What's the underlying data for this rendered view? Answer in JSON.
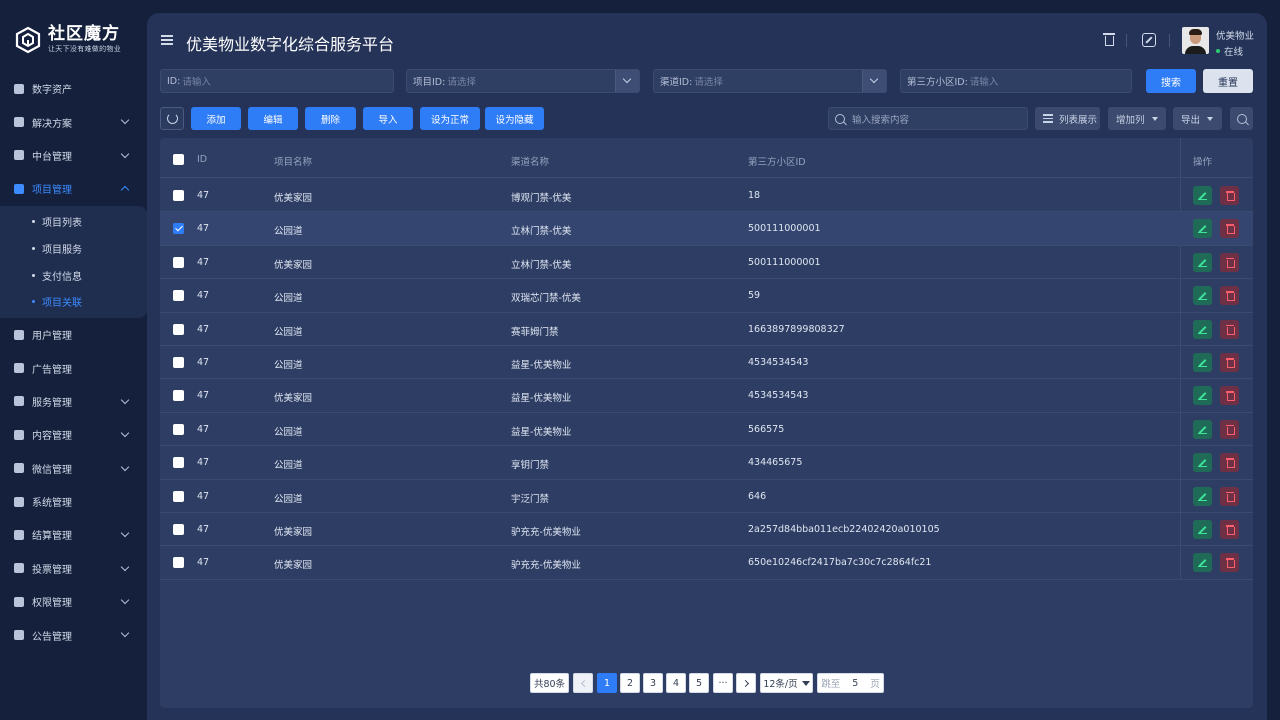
{
  "brand": {
    "title": "社区魔方",
    "subtitle": "让天下没有难做的物业"
  },
  "sidebar": {
    "items": [
      {
        "label": "数字资产",
        "icon": "digital-assets-icon",
        "chevron": false
      },
      {
        "label": "解决方案",
        "icon": "shield-icon",
        "chevron": true
      },
      {
        "label": "中台管理",
        "icon": "cube-icon",
        "chevron": true
      },
      {
        "label": "项目管理",
        "icon": "folder-icon",
        "chevron": true,
        "active": true
      },
      {
        "label": "用户管理",
        "icon": "user-icon",
        "chevron": false
      },
      {
        "label": "广告管理",
        "icon": "ad-icon",
        "chevron": false
      },
      {
        "label": "服务管理",
        "icon": "heart-icon",
        "chevron": true
      },
      {
        "label": "内容管理",
        "icon": "content-icon",
        "chevron": true
      },
      {
        "label": "微信管理",
        "icon": "wechat-icon",
        "chevron": true
      },
      {
        "label": "系统管理",
        "icon": "gear-icon",
        "chevron": false
      },
      {
        "label": "结算管理",
        "icon": "settlement-icon",
        "chevron": true
      },
      {
        "label": "投票管理",
        "icon": "vote-icon",
        "chevron": true
      },
      {
        "label": "权限管理",
        "icon": "permission-icon",
        "chevron": true
      },
      {
        "label": "公告管理",
        "icon": "megaphone-icon",
        "chevron": true
      }
    ],
    "subitems": [
      "项目列表",
      "项目服务",
      "支付信息",
      "项目关联"
    ],
    "active_sub": "项目关联"
  },
  "header": {
    "title": "优美物业数字化综合服务平台",
    "user_name": "优美物业",
    "user_status": "在线"
  },
  "filters": {
    "id_label": "ID:",
    "id_placeholder": "请输入",
    "project_label": "项目ID:",
    "project_placeholder": "请选择",
    "channel_label": "渠道ID:",
    "channel_placeholder": "请选择",
    "third_label": "第三方小区ID:",
    "third_placeholder": "请输入",
    "search": "搜索",
    "reset": "重置"
  },
  "toolbar": {
    "add": "添加",
    "edit": "编辑",
    "delete": "删除",
    "import": "导入",
    "set_normal": "设为正常",
    "set_hidden": "设为隐藏",
    "search_placeholder": "输入搜索内容",
    "list_view": "列表展示",
    "add_column": "增加列",
    "export": "导出"
  },
  "table": {
    "columns": [
      "ID",
      "项目名称",
      "渠道名称",
      "第三方小区ID",
      "操作"
    ],
    "rows": [
      {
        "id": "47",
        "project": "优美家园",
        "channel": "博观门禁-优美",
        "third": "18",
        "checked": false
      },
      {
        "id": "47",
        "project": "公园道",
        "channel": "立林门禁-优美",
        "third": "500111000001",
        "checked": true
      },
      {
        "id": "47",
        "project": "优美家园",
        "channel": "立林门禁-优美",
        "third": "500111000001",
        "checked": false
      },
      {
        "id": "47",
        "project": "公园道",
        "channel": "双瑞芯门禁-优美",
        "third": "59",
        "checked": false
      },
      {
        "id": "47",
        "project": "公园道",
        "channel": "赛菲姆门禁",
        "third": "1663897899808327",
        "checked": false
      },
      {
        "id": "47",
        "project": "公园道",
        "channel": "益星-优美物业",
        "third": "4534534543",
        "checked": false
      },
      {
        "id": "47",
        "project": "优美家园",
        "channel": "益星-优美物业",
        "third": "4534534543",
        "checked": false
      },
      {
        "id": "47",
        "project": "公园道",
        "channel": "益星-优美物业",
        "third": "566575",
        "checked": false
      },
      {
        "id": "47",
        "project": "公园道",
        "channel": "享钥门禁",
        "third": "434465675",
        "checked": false
      },
      {
        "id": "47",
        "project": "公园道",
        "channel": "宇泛门禁",
        "third": "646",
        "checked": false
      },
      {
        "id": "47",
        "project": "优美家园",
        "channel": "驴充充-优美物业",
        "third": "2a257d84bba011ecb22402420a010105",
        "checked": false
      },
      {
        "id": "47",
        "project": "优美家园",
        "channel": "驴充充-优美物业",
        "third": "650e10246cf2417ba7c30c7c2864fc21",
        "checked": false
      }
    ]
  },
  "pagination": {
    "total": "共80条",
    "pages": [
      "1",
      "2",
      "3",
      "4",
      "5"
    ],
    "current": "1",
    "ellipsis": "···",
    "page_size": "12条/页",
    "jump_label": "跳至",
    "jump_value": "5",
    "jump_suffix": "页"
  },
  "colors": {
    "accent": "#2f7df6",
    "panel": "#243357",
    "sidebar": "#14203c",
    "edit": "#3fe39a",
    "delete": "#ff5e6c"
  }
}
